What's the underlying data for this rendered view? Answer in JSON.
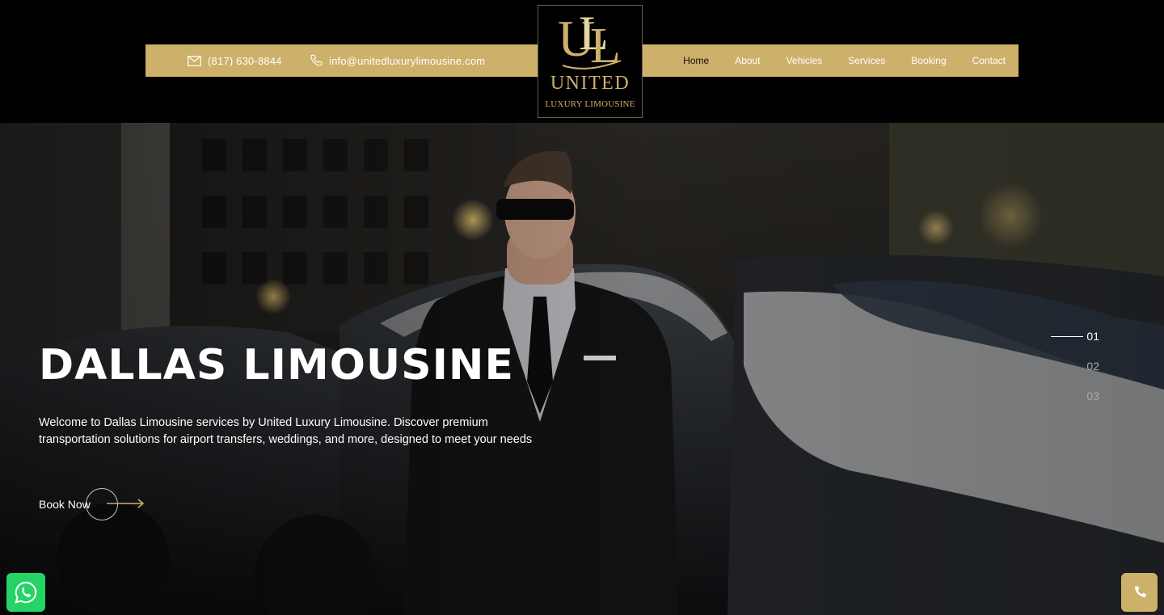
{
  "header": {
    "phone": "(817) 630-8844",
    "email": "info@unitedluxurylimousine.com",
    "nav": [
      "Home",
      "About",
      "Vehicles",
      "Services",
      "Booking",
      "Contact"
    ],
    "active_nav": "Home"
  },
  "logo": {
    "monogram": "ULL",
    "title": "UNITED",
    "subtitle": "LUXURY LIMOUSINE"
  },
  "hero": {
    "title": "DALLAS LIMOUSINE",
    "description": "Welcome to Dallas Limousine services by United Luxury Limousine. Discover premium transportation solutions for airport transfers, weddings, and more, designed to meet your needs",
    "cta": "Book Now",
    "slides": [
      "01",
      "02",
      "03"
    ],
    "active_slide": "01"
  },
  "icons": {
    "phone_contact": "mail-icon",
    "email_contact": "phone-icon",
    "whatsapp": "whatsapp-icon",
    "call": "phone-icon"
  },
  "colors": {
    "gold": "#cdb06a",
    "whatsapp_green": "#25d366",
    "header_bg": "#000000"
  }
}
